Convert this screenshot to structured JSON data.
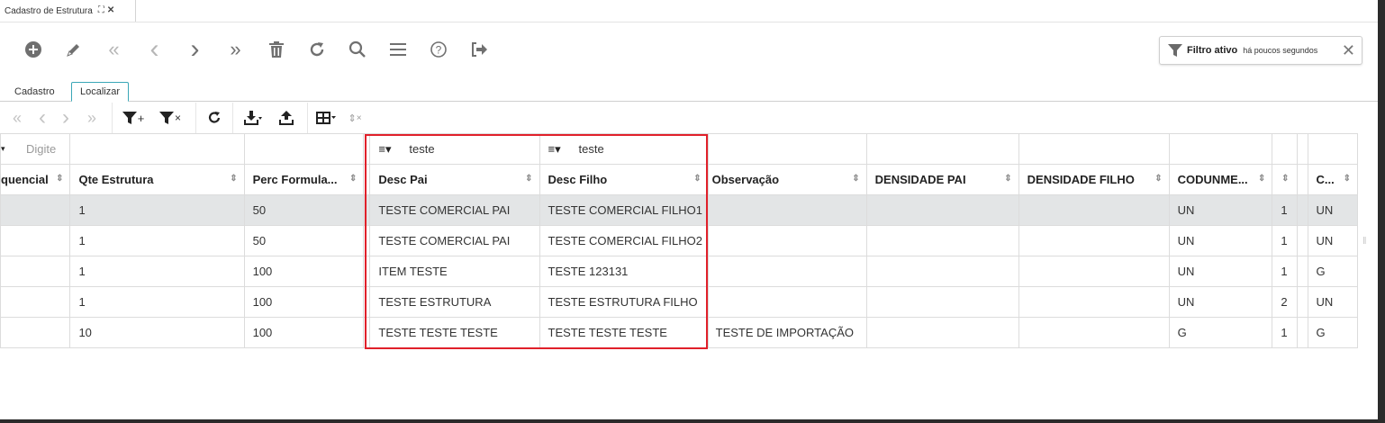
{
  "window": {
    "tab_title": "Cadastro de Estrutura",
    "tab_expand": "⛶",
    "tab_close": "✕"
  },
  "toolbar": {
    "add": "add-icon",
    "edit": "pencil-icon",
    "first": "«",
    "prev": "‹",
    "next": "›",
    "last": "»",
    "delete": "trash-icon",
    "refresh": "reload-icon",
    "search": "search-icon",
    "menu": "menu-icon",
    "help": "help-icon",
    "exit": "exit-icon"
  },
  "filter_badge": {
    "label": "Filtro ativo",
    "time": "há poucos segundos",
    "close": "✕"
  },
  "subtabs": [
    {
      "label": "Cadastro"
    },
    {
      "label": "Localizar"
    }
  ],
  "grid_toolbar": {
    "first": "«",
    "prev": "‹",
    "next": "›",
    "last": "»",
    "add_filter": "+",
    "clear_filter": "×",
    "columns_clear": "×"
  },
  "table": {
    "filter_row": {
      "col0_op": "▾",
      "col0_placeholder": "Digite",
      "desc_pai_op": "≡▾",
      "desc_pai_value": "teste",
      "desc_filho_op": "≡▾",
      "desc_filho_value": "teste"
    },
    "headers": [
      "quencial",
      "Qte Estrutura",
      "Perc Formula...",
      "Desc Pai",
      "Desc Filho",
      "Observação",
      "DENSIDADE PAI",
      "DENSIDADE FILHO",
      "CODUNME...",
      "",
      "C..."
    ],
    "rows": [
      {
        "c0": "",
        "qte": "1",
        "perc": "50",
        "pai": "TESTE COMERCIAL PAI",
        "filho": "TESTE COMERCIAL FILHO1",
        "obs": "",
        "dpai": "",
        "dfilho": "",
        "cod": "UN",
        "n": "1",
        "c": "UN"
      },
      {
        "c0": "",
        "qte": "1",
        "perc": "50",
        "pai": "TESTE COMERCIAL PAI",
        "filho": "TESTE COMERCIAL FILHO2",
        "obs": "",
        "dpai": "",
        "dfilho": "",
        "cod": "UN",
        "n": "1",
        "c": "UN"
      },
      {
        "c0": "",
        "qte": "1",
        "perc": "100",
        "pai": "ITEM TESTE",
        "filho": "TESTE 123131",
        "obs": "",
        "dpai": "",
        "dfilho": "",
        "cod": "UN",
        "n": "1",
        "c": "G"
      },
      {
        "c0": "",
        "qte": "1",
        "perc": "100",
        "pai": "TESTE ESTRUTURA",
        "filho": "TESTE ESTRUTURA FILHO",
        "obs": "",
        "dpai": "",
        "dfilho": "",
        "cod": "UN",
        "n": "2",
        "c": "UN"
      },
      {
        "c0": "",
        "qte": "10",
        "perc": "100",
        "pai": "TESTE TESTE TESTE",
        "filho": "TESTE TESTE TESTE",
        "obs": "TESTE DE IMPORTAÇÃO",
        "dpai": "",
        "dfilho": "",
        "cod": "G",
        "n": "1",
        "c": "G"
      }
    ]
  },
  "colors": {
    "accent": "#3aa7b7",
    "highlight": "#e0202a",
    "selected_row": "#e3e5e6"
  }
}
